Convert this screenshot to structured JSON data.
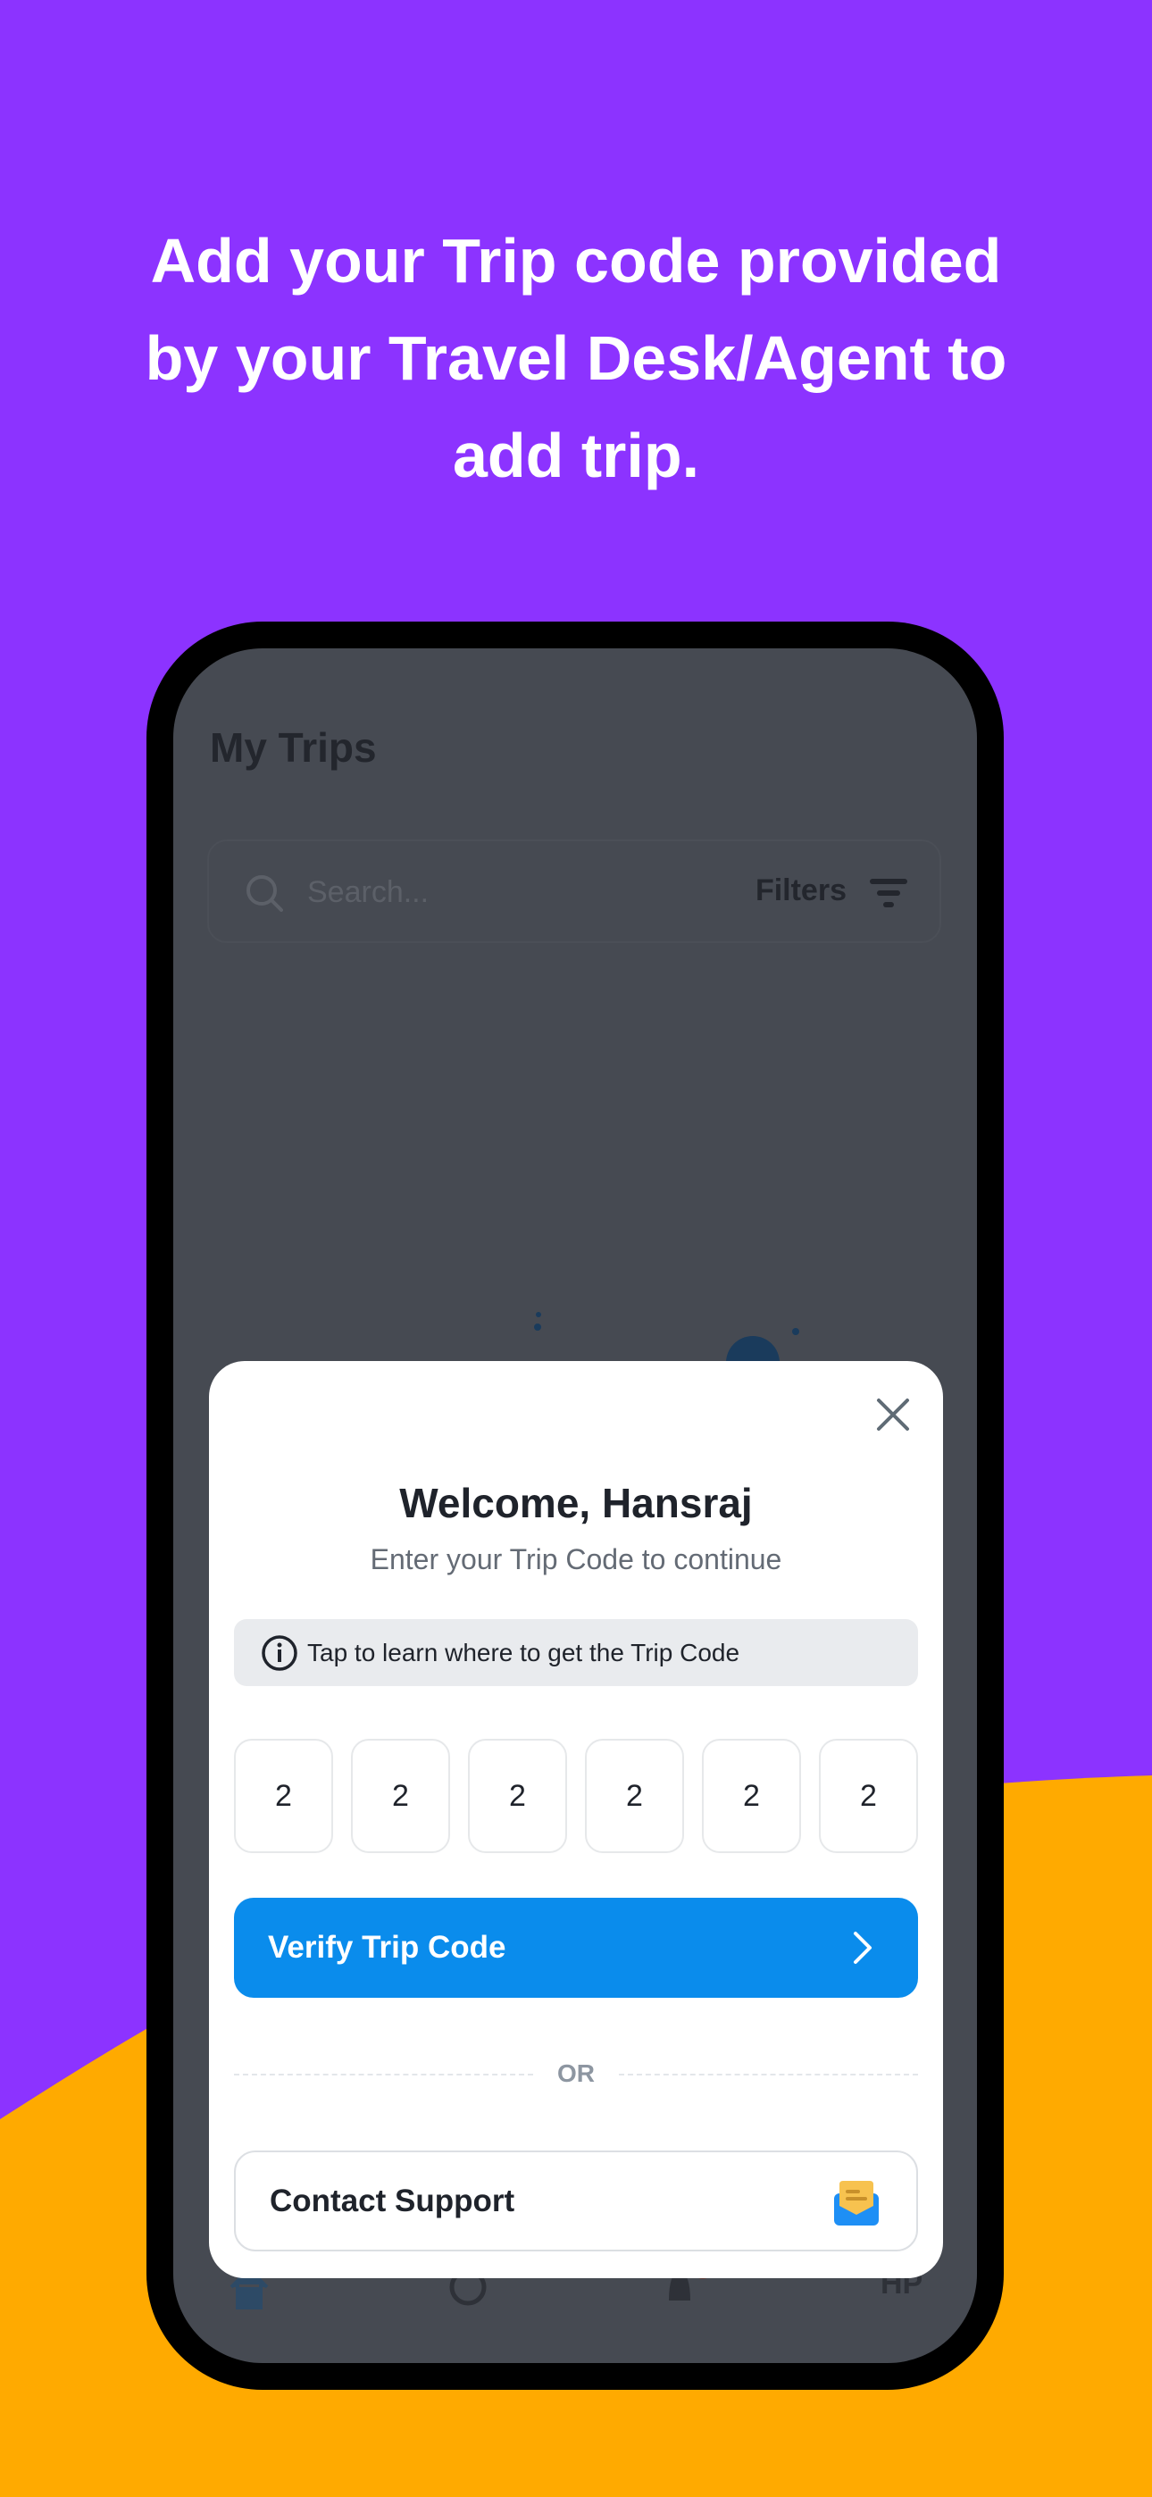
{
  "colors": {
    "background_purple": "#8C33FF",
    "wave_orange": "#FFAA00",
    "overlay": "#464A52",
    "primary_blue": "#0A8CEC"
  },
  "headline": [
    "Add your Trip code provided",
    "by your Travel Desk/Agent to",
    "add trip."
  ],
  "app": {
    "title": "My Trips",
    "search": {
      "placeholder": "Search...",
      "icon": "search-icon"
    },
    "filters": {
      "label": "Filters",
      "icon": "filter-icon"
    },
    "bottom_nav": [
      {
        "icon": "home-icon"
      },
      {
        "icon": "support-agent-icon"
      },
      {
        "icon": "notification-bell-icon"
      },
      {
        "label": "HP"
      }
    ]
  },
  "modal": {
    "close_icon": "close-icon",
    "title": "Welcome, Hansraj",
    "subtitle": "Enter your Trip Code to continue",
    "info": {
      "icon": "info-icon",
      "text": "Tap to learn where to get the Trip Code"
    },
    "code_digits": [
      "2",
      "2",
      "2",
      "2",
      "2",
      "2"
    ],
    "verify_label": "Verify Trip Code",
    "divider_text": "OR",
    "contact_label": "Contact Support",
    "contact_icon": "mail-envelope-icon"
  }
}
